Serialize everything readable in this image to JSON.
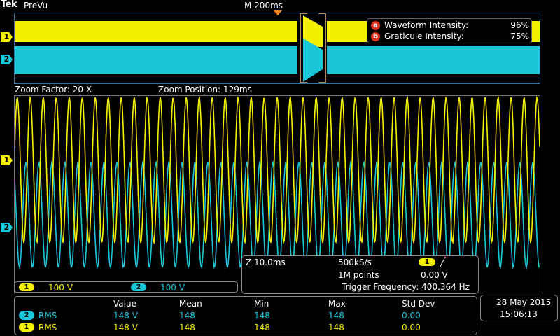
{
  "header": {
    "brand": "Tek",
    "mode": "PreVu",
    "horizontal_scale": "M 200ms"
  },
  "channels": {
    "ch1": {
      "label": "1",
      "color": "#f5f000",
      "scale": "100 V"
    },
    "ch2": {
      "label": "2",
      "color": "#1ac6d8",
      "scale": "100 V"
    }
  },
  "intensity": {
    "waveform": {
      "key": "a",
      "label": "Waveform Intensity:",
      "value": "96%"
    },
    "graticule": {
      "key": "b",
      "label": "Graticule Intensity:",
      "value": "75%"
    }
  },
  "zoom": {
    "factor": "Zoom Factor: 20 X",
    "position": "Zoom Position: 129ms"
  },
  "acquisition": {
    "zoom_scale": "Z 10.0ms",
    "sample_rate": "500kS/s",
    "record_length": "1M points",
    "trigger_channel": "1",
    "trigger_slope": "╱",
    "trigger_level": "0.00 V",
    "trigger_frequency": "Trigger Frequency: 400.364 Hz"
  },
  "measurements": {
    "headers": {
      "value": "Value",
      "mean": "Mean",
      "min": "Min",
      "max": "Max",
      "std": "Std Dev"
    },
    "rows": [
      {
        "channel": "2",
        "type": "RMS",
        "value": "148 V",
        "mean": "148",
        "min": "148",
        "max": "148",
        "std": "0.00"
      },
      {
        "channel": "1",
        "type": "RMS",
        "value": "148 V",
        "mean": "148",
        "min": "148",
        "max": "148",
        "std": "0.00"
      }
    ]
  },
  "datetime": {
    "date": "28 May 2015",
    "time": "15:06:13"
  }
}
